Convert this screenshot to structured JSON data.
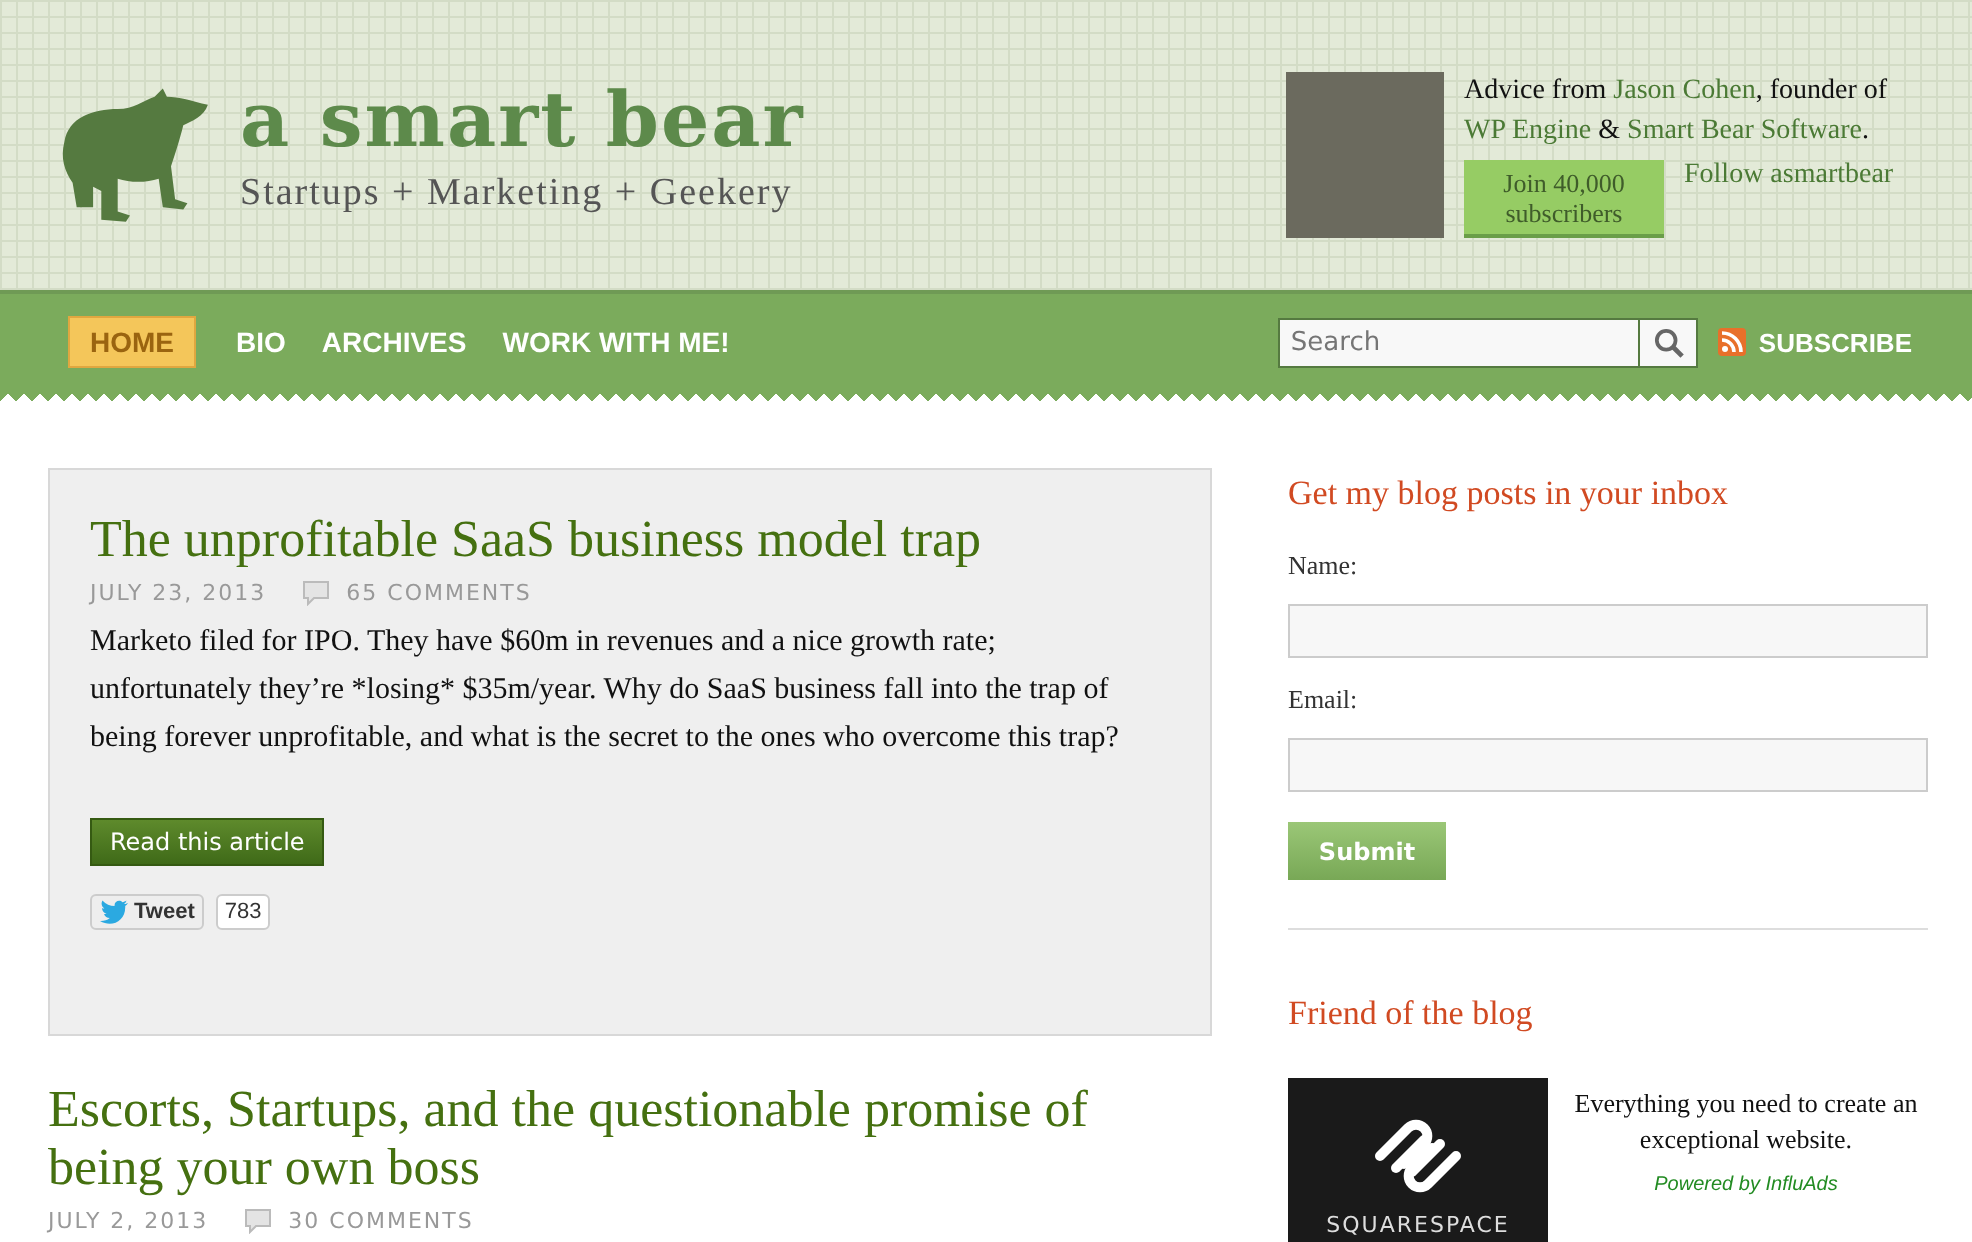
{
  "header": {
    "logo_title": "a smart bear",
    "tagline": "Startups + Marketing + Geekery",
    "bio_parts": [
      {
        "text": "Advice from ",
        "kind": "plain"
      },
      {
        "text": "Jason Cohen",
        "kind": "link"
      },
      {
        "text": ", founder of ",
        "kind": "plain"
      },
      {
        "text": "WP Engine",
        "kind": "link"
      },
      {
        "text": " & ",
        "kind": "plain"
      },
      {
        "text": "Smart Bear Software",
        "kind": "link"
      },
      {
        "text": ".",
        "kind": "plain"
      }
    ],
    "join_button": "Join 40,000 subscribers",
    "follow_link": "Follow asmartbear"
  },
  "nav": {
    "items": [
      {
        "label": "HOME",
        "selected": true
      },
      {
        "label": "BIO",
        "selected": false
      },
      {
        "label": "ARCHIVES",
        "selected": false
      },
      {
        "label": "WORK WITH ME!",
        "selected": false
      }
    ],
    "search": {
      "placeholder": "Search"
    },
    "subscribe": "SUBSCRIBE"
  },
  "posts": [
    {
      "title": "The unprofitable SaaS business model trap",
      "date": "JULY 23, 2013",
      "comments": "65 COMMENTS",
      "featured": true,
      "excerpt": "Marketo filed for IPO. They have $60m in revenues and a nice growth rate; unfortunately they’re *losing* $35m/year. Why do SaaS business fall into the trap of being forever unprofitable, and what is the secret to the ones who overcome this trap?",
      "button": "Read this article",
      "tweet": "Tweet",
      "tweet_count": "783"
    },
    {
      "title": "Escorts, Startups, and the questionable promise of being your own boss",
      "date": "JULY 2, 2013",
      "comments": "30 COMMENTS",
      "featured": false
    }
  ],
  "sidebar": {
    "signup": {
      "heading": "Get my blog posts in your inbox",
      "fields": [
        {
          "label": "Name:"
        },
        {
          "label": "Email:"
        }
      ],
      "submit": "Submit"
    },
    "friend": {
      "heading": "Friend of the blog",
      "ad_brand": "SQUARESPACE",
      "ad_text": "Everything you need to create an exceptional website.",
      "ad_credit": "Powered by InfluAds"
    }
  }
}
